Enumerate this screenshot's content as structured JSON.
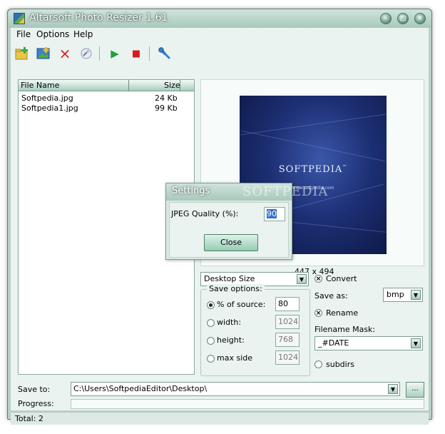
{
  "window": {
    "title": "Altarsoft Photo Resizer 1.61",
    "min_glyph": "–",
    "max_glyph": "□",
    "close_glyph": "×"
  },
  "menu": {
    "file": "File",
    "options": "Options",
    "help": "Help"
  },
  "toolbar": {
    "add_icon": "add-files-icon",
    "add_folder_icon": "add-folder-icon",
    "remove_icon": "×",
    "clear_icon": "clear-icon",
    "start_icon": "▶",
    "stop_icon": "■",
    "settings_icon": "wrench-icon"
  },
  "filelist": {
    "columns": {
      "name": "File Name",
      "size": "Size"
    },
    "rows": [
      {
        "name": "Softpedia.jpg",
        "size": "24 Kb"
      },
      {
        "name": "Softpedia1.jpg",
        "size": "99 Kb"
      }
    ]
  },
  "preview": {
    "image_title": "SOFTPEDIA",
    "image_tm": "™",
    "image_url": "www.softpedia.com",
    "dimensions": "447 x 494"
  },
  "size_preset": "Desktop Size",
  "save_options": {
    "title": "Save options:",
    "percent_label": "% of source:",
    "percent_value": "80",
    "width_label": "width:",
    "width_value": "1024",
    "height_label": "height:",
    "height_value": "768",
    "maxside_label": "max side",
    "maxside_value": "1024"
  },
  "convert": {
    "label": "Convert",
    "save_as_label": "Save as:",
    "save_as_value": "bmp",
    "rename_label": "Rename",
    "mask_label": "Filename Mask:",
    "mask_value": "_#DATE",
    "subdirs_label": "subdirs"
  },
  "save_to": {
    "label": "Save to:",
    "path": "C:\\Users\\SoftpediaEditor\\Desktop\\",
    "browse": "..."
  },
  "progress": {
    "label": "Progress:",
    "value": 0
  },
  "status": {
    "total": "Total: 2"
  },
  "dialog": {
    "title": "Settings",
    "quality_label": "JPEG Quality (%):",
    "quality_value": "90",
    "close_label": "Close"
  },
  "watermark": "SOFTPEDIA",
  "dd_arrow": "▼",
  "check_mark": "×"
}
